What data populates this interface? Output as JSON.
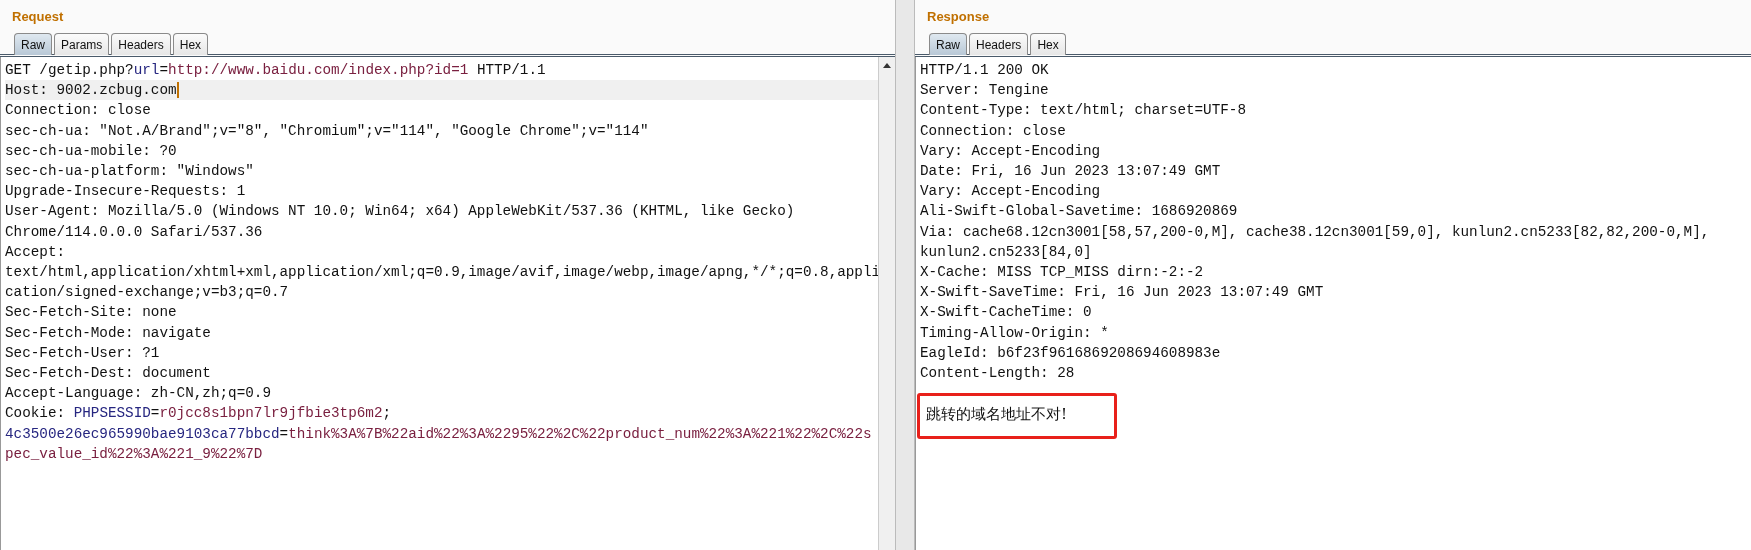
{
  "request": {
    "title": "Request",
    "tabs": [
      {
        "label": "Raw",
        "selected": true
      },
      {
        "label": "Params",
        "selected": false
      },
      {
        "label": "Headers",
        "selected": false
      },
      {
        "label": "Hex",
        "selected": false
      }
    ],
    "lines": [
      {
        "highlighted": false,
        "segments": [
          {
            "kind": "plain",
            "text": "GET /getip.php?"
          },
          {
            "kind": "name",
            "text": "url"
          },
          {
            "kind": "plain",
            "text": "="
          },
          {
            "kind": "value",
            "text": "http://www.baidu.com/index.php?id=1"
          },
          {
            "kind": "plain",
            "text": " HTTP/1.1"
          }
        ]
      },
      {
        "highlighted": true,
        "segments": [
          {
            "kind": "plain",
            "text": "Host: 9002.zcbug.com"
          }
        ]
      },
      {
        "highlighted": false,
        "segments": [
          {
            "kind": "plain",
            "text": "Connection: close"
          }
        ]
      },
      {
        "highlighted": false,
        "segments": [
          {
            "kind": "plain",
            "text": "sec-ch-ua: \"Not.A/Brand\";v=\"8\", \"Chromium\";v=\"114\", \"Google Chrome\";v=\"114\""
          }
        ]
      },
      {
        "highlighted": false,
        "segments": [
          {
            "kind": "plain",
            "text": "sec-ch-ua-mobile: ?0"
          }
        ]
      },
      {
        "highlighted": false,
        "segments": [
          {
            "kind": "plain",
            "text": "sec-ch-ua-platform: \"Windows\""
          }
        ]
      },
      {
        "highlighted": false,
        "segments": [
          {
            "kind": "plain",
            "text": "Upgrade-Insecure-Requests: 1"
          }
        ]
      },
      {
        "highlighted": false,
        "segments": [
          {
            "kind": "plain",
            "text": "User-Agent: Mozilla/5.0 (Windows NT 10.0; Win64; x64) AppleWebKit/537.36 (KHTML, like Gecko)"
          }
        ]
      },
      {
        "highlighted": false,
        "segments": [
          {
            "kind": "plain",
            "text": "Chrome/114.0.0.0 Safari/537.36"
          }
        ]
      },
      {
        "highlighted": false,
        "segments": [
          {
            "kind": "plain",
            "text": "Accept:"
          }
        ]
      },
      {
        "highlighted": false,
        "segments": [
          {
            "kind": "plain",
            "text": "text/html,application/xhtml+xml,application/xml;q=0.9,image/avif,image/webp,image/apng,*/*;q=0.8,appli"
          }
        ]
      },
      {
        "highlighted": false,
        "segments": [
          {
            "kind": "plain",
            "text": "cation/signed-exchange;v=b3;q=0.7"
          }
        ]
      },
      {
        "highlighted": false,
        "segments": [
          {
            "kind": "plain",
            "text": "Sec-Fetch-Site: none"
          }
        ]
      },
      {
        "highlighted": false,
        "segments": [
          {
            "kind": "plain",
            "text": "Sec-Fetch-Mode: navigate"
          }
        ]
      },
      {
        "highlighted": false,
        "segments": [
          {
            "kind": "plain",
            "text": "Sec-Fetch-User: ?1"
          }
        ]
      },
      {
        "highlighted": false,
        "segments": [
          {
            "kind": "plain",
            "text": "Sec-Fetch-Dest: document"
          }
        ]
      },
      {
        "highlighted": false,
        "segments": [
          {
            "kind": "plain",
            "text": "Accept-Language: zh-CN,zh;q=0.9"
          }
        ]
      },
      {
        "highlighted": false,
        "segments": [
          {
            "kind": "plain",
            "text": "Cookie: "
          },
          {
            "kind": "name",
            "text": "PHPSESSID"
          },
          {
            "kind": "plain",
            "text": "="
          },
          {
            "kind": "value",
            "text": "r0jcc8s1bpn7lr9jfbie3tp6m2"
          },
          {
            "kind": "plain",
            "text": ";"
          }
        ]
      },
      {
        "highlighted": false,
        "segments": [
          {
            "kind": "name",
            "text": "4c3500e26ec965990bae9103ca77bbcd"
          },
          {
            "kind": "plain",
            "text": "="
          },
          {
            "kind": "value",
            "text": "think%3A%7B%22aid%22%3A%2295%22%2C%22product_num%22%3A%221%22%2C%22s"
          }
        ]
      },
      {
        "highlighted": false,
        "segments": [
          {
            "kind": "value",
            "text": "pec_value_id%22%3A%221_9%22%7D"
          }
        ]
      }
    ]
  },
  "response": {
    "title": "Response",
    "tabs": [
      {
        "label": "Raw",
        "selected": true
      },
      {
        "label": "Headers",
        "selected": false
      },
      {
        "label": "Hex",
        "selected": false
      }
    ],
    "lines": [
      "HTTP/1.1 200 OK",
      "Server: Tengine",
      "Content-Type: text/html; charset=UTF-8",
      "Connection: close",
      "Vary: Accept-Encoding",
      "Date: Fri, 16 Jun 2023 13:07:49 GMT",
      "Vary: Accept-Encoding",
      "Ali-Swift-Global-Savetime: 1686920869",
      "Via: cache68.12cn3001[58,57,200-0,M], cache38.12cn3001[59,0], kunlun2.cn5233[82,82,200-0,M],",
      "kunlun2.cn5233[84,0]",
      "X-Cache: MISS TCP_MISS dirn:-2:-2",
      "X-Swift-SaveTime: Fri, 16 Jun 2023 13:07:49 GMT",
      "X-Swift-CacheTime: 0",
      "Timing-Allow-Origin: *",
      "EagleId: b6f23f9616869208694608983e",
      "Content-Length: 28"
    ],
    "body": "跳转的域名地址不对!"
  }
}
